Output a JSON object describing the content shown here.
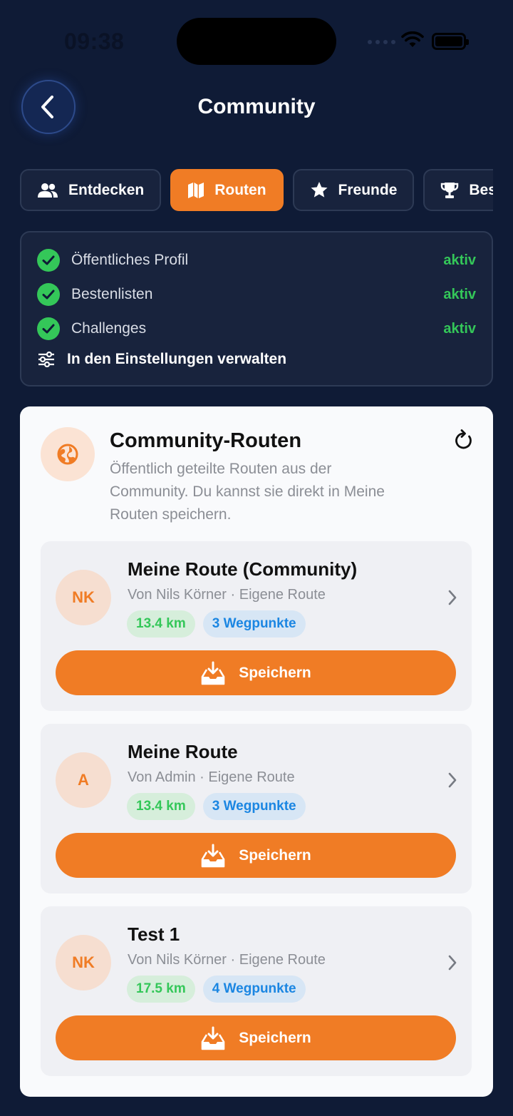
{
  "status_bar": {
    "time": "09:38"
  },
  "header": {
    "title": "Community"
  },
  "tabs": [
    {
      "label": "Entdecken",
      "icon": "people-icon",
      "active": false
    },
    {
      "label": "Routen",
      "icon": "map-icon",
      "active": true
    },
    {
      "label": "Freunde",
      "icon": "star-icon",
      "active": false
    },
    {
      "label": "Bestenlisten",
      "icon": "trophy-icon",
      "active": false
    }
  ],
  "privacy": {
    "items": [
      {
        "label": "Öffentliches Profil",
        "status": "aktiv"
      },
      {
        "label": "Bestenlisten",
        "status": "aktiv"
      },
      {
        "label": "Challenges",
        "status": "aktiv"
      }
    ],
    "manage_label": "In den Einstellungen verwalten"
  },
  "community": {
    "title": "Community-Routen",
    "description": "Öffentlich geteilte Routen aus der Community. Du kannst sie direkt in Meine Routen speichern.",
    "routes": [
      {
        "initials": "NK",
        "title": "Meine Route (Community)",
        "meta": "Von Nils Körner · Eigene Route",
        "distance": "13.4 km",
        "waypoints": "3 Wegpunkte",
        "save_label": "Speichern"
      },
      {
        "initials": "A",
        "title": "Meine Route",
        "meta": "Von Admin · Eigene Route",
        "distance": "13.4 km",
        "waypoints": "3 Wegpunkte",
        "save_label": "Speichern"
      },
      {
        "initials": "NK",
        "title": "Test 1",
        "meta": "Von Nils Körner · Eigene Route",
        "distance": "17.5 km",
        "waypoints": "4 Wegpunkte",
        "save_label": "Speichern"
      }
    ]
  },
  "colors": {
    "background": "#0f1b36",
    "accent": "#f07c25",
    "success": "#34c759",
    "waypoint_blue": "#1b86e2"
  }
}
